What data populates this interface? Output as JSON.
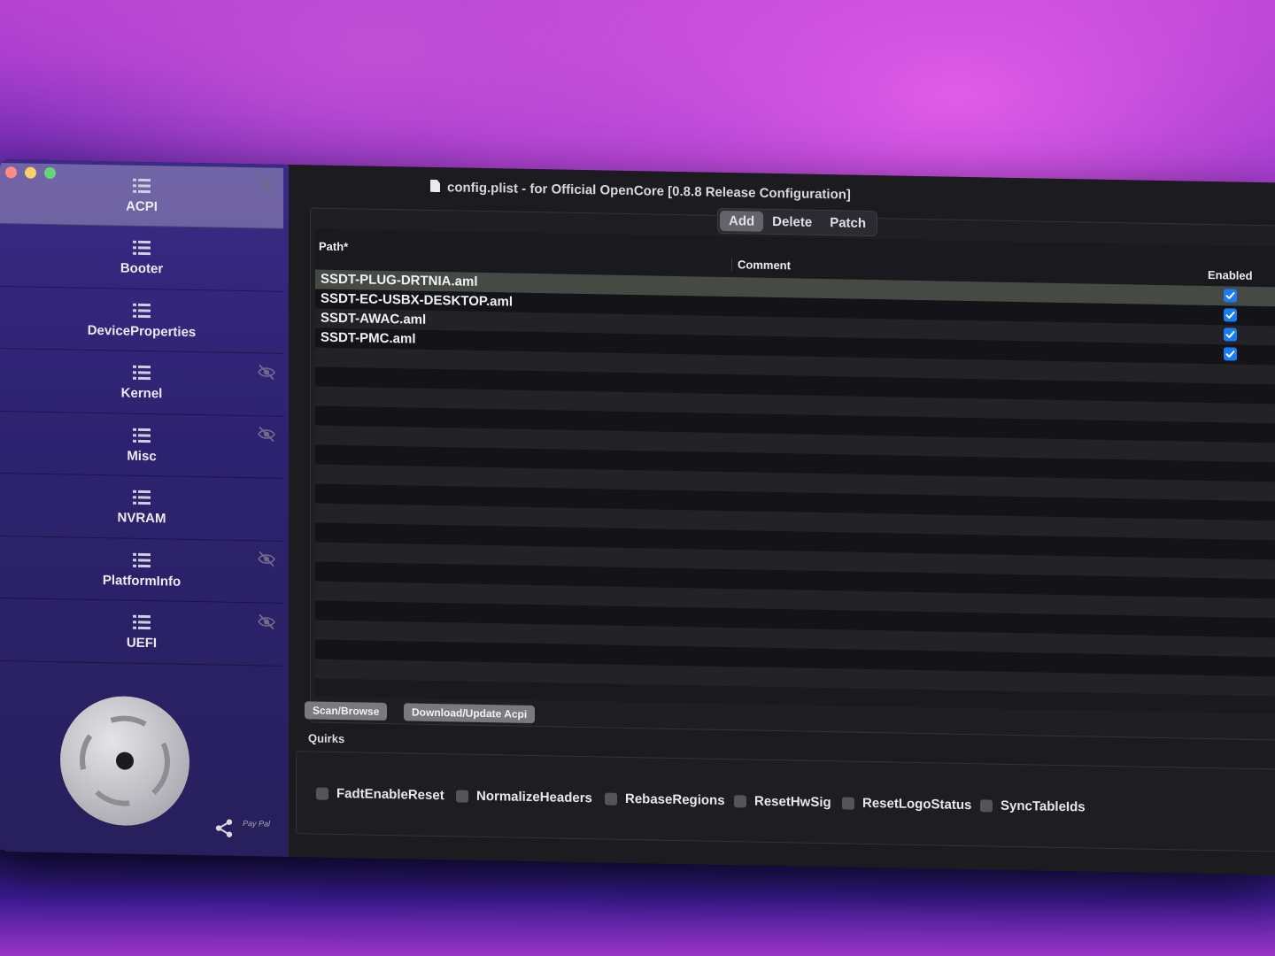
{
  "window": {
    "title": "config.plist - for Official OpenCore [0.8.8 Release Configuration]"
  },
  "sidebar": {
    "items": [
      {
        "label": "ACPI",
        "active": true,
        "hidden_icon": true
      },
      {
        "label": "Booter",
        "active": false,
        "hidden_icon": false
      },
      {
        "label": "DeviceProperties",
        "active": false,
        "hidden_icon": false
      },
      {
        "label": "Kernel",
        "active": false,
        "hidden_icon": true
      },
      {
        "label": "Misc",
        "active": false,
        "hidden_icon": true
      },
      {
        "label": "NVRAM",
        "active": false,
        "hidden_icon": false
      },
      {
        "label": "PlatformInfo",
        "active": false,
        "hidden_icon": true
      },
      {
        "label": "UEFI",
        "active": false,
        "hidden_icon": true
      }
    ],
    "paypal_label": "Pay Pal"
  },
  "tabs": {
    "items": [
      "Add",
      "Delete",
      "Patch"
    ],
    "selected": "Add"
  },
  "table": {
    "columns": {
      "path": "Path*",
      "comment": "Comment",
      "enabled": "Enabled"
    },
    "rows": [
      {
        "path": "SSDT-PLUG-DRTNIA.aml",
        "comment": "",
        "enabled": true,
        "selected": true
      },
      {
        "path": "SSDT-EC-USBX-DESKTOP.aml",
        "comment": "",
        "enabled": true,
        "selected": false
      },
      {
        "path": "SSDT-AWAC.aml",
        "comment": "",
        "enabled": true,
        "selected": false
      },
      {
        "path": "SSDT-PMC.aml",
        "comment": "",
        "enabled": true,
        "selected": false
      }
    ]
  },
  "buttons": {
    "scan": "Scan/Browse",
    "download": "Download/Update Acpi"
  },
  "quirks": {
    "label": "Quirks",
    "items": [
      {
        "label": "FadtEnableReset",
        "checked": false
      },
      {
        "label": "NormalizeHeaders",
        "checked": false
      },
      {
        "label": "RebaseRegions",
        "checked": false
      },
      {
        "label": "ResetHwSig",
        "checked": false
      },
      {
        "label": "ResetLogoStatus",
        "checked": false
      },
      {
        "label": "SyncTableIds",
        "checked": false
      }
    ]
  },
  "colors": {
    "accent_checkbox": "#1a7cf5",
    "sidebar_top": "#3b2a86",
    "selected_row": "#454a45"
  }
}
